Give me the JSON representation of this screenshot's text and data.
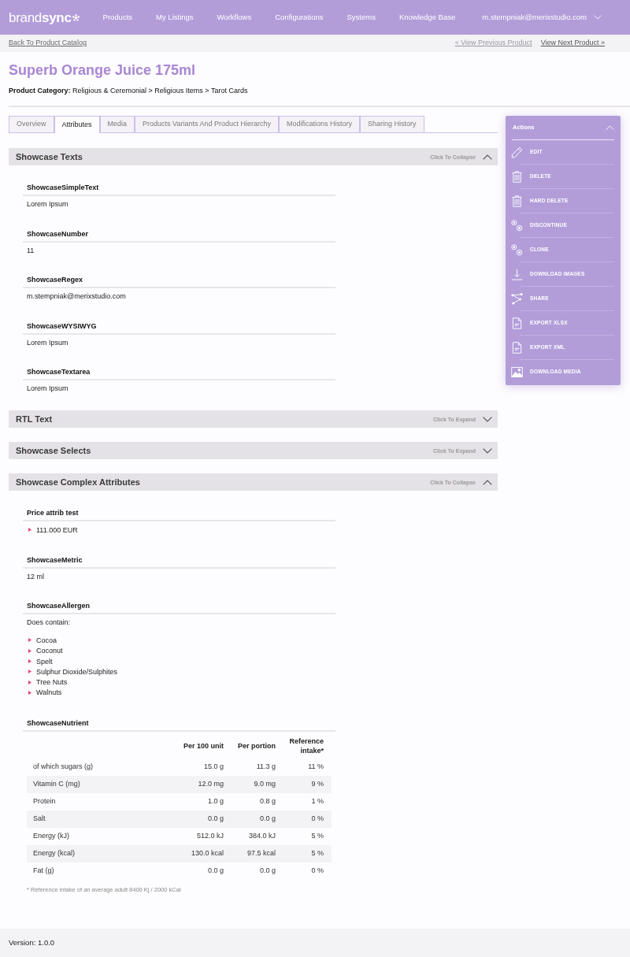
{
  "header": {
    "logo": "brand**sync**",
    "nav": [
      "Products",
      "My Listings",
      "Workflows",
      "Configurations",
      "Systems",
      "Knowledge Base"
    ],
    "user": "m.stempniak@merixstudio.com"
  },
  "subnav": {
    "back": "Back To Product Catalog",
    "previous": {
      "label": "« View Previous Product",
      "disabled": true
    },
    "next": {
      "label": "View Next Product »",
      "disabled": false
    }
  },
  "product": {
    "title": "Superb Orange Juice 175ml",
    "category": "**Product Category:** Religious & Ceremonial > Religious Items > Tarot Cards"
  },
  "tabs": [
    {
      "label": "Overview",
      "selected": false
    },
    {
      "label": "Attributes",
      "selected": true
    },
    {
      "label": "Media",
      "selected": false
    },
    {
      "label": "Products Variants And Product Hierarchy",
      "selected": false
    },
    {
      "label": "Modifications History",
      "selected": false
    },
    {
      "label": "Sharing History",
      "selected": false
    }
  ],
  "sections": [
    {
      "title": "Showcase Texts",
      "toggle": "Click To Collapse",
      "expanded": true,
      "attributes": [
        {
          "kind": "text",
          "label": "ShowcaseSimpleText",
          "value": "Lorem Ipsum"
        },
        {
          "kind": "text",
          "label": "ShowcaseNumber",
          "value": "11"
        },
        {
          "kind": "text",
          "label": "ShowcaseRegex",
          "value": "m.stempniak@merixstudio.com"
        },
        {
          "kind": "text",
          "label": "ShowcaseWYSIWYG",
          "value": "Lorem Ipsum"
        },
        {
          "kind": "text",
          "label": "ShowcaseTextarea",
          "value": "Lorem Ipsum"
        }
      ]
    },
    {
      "title": "RTL Text",
      "toggle": "Click To Expand",
      "expanded": false
    },
    {
      "title": "Showcase Selects",
      "toggle": "Click To Expand",
      "expanded": false
    },
    {
      "title": "Showcase Complex Attributes",
      "toggle": "Click To Collapse",
      "expanded": true,
      "attributes": [
        {
          "kind": "list",
          "label": "Price attrib test",
          "items": [
            "111.000 EUR"
          ]
        },
        {
          "kind": "text",
          "label": "ShowcaseMetric",
          "value": "12 ml"
        },
        {
          "kind": "list",
          "label": "ShowcaseAllergen",
          "intro": "Does contain:",
          "items": [
            "Cocoa",
            "Coconut",
            "Spelt",
            "Sulphur Dioxide/Sulphites",
            "Tree Nuts",
            "Walnuts"
          ]
        },
        {
          "kind": "table",
          "label": "ShowcaseNutrient",
          "columns": [
            "",
            "Per 100 unit",
            "Per portion",
            "Reference intake*"
          ],
          "rows": [
            [
              "of which sugars (g)",
              "15.0 g",
              "11.3 g",
              "11 %"
            ],
            [
              "Vitamin C (mg)",
              "12.0 mg",
              "9.0 mg",
              "9 %"
            ],
            [
              "Protein",
              "1.0 g",
              "0.8 g",
              "1 %"
            ],
            [
              "Salt",
              "0.0 g",
              "0.0 g",
              "0 %"
            ],
            [
              "Energy (kJ)",
              "512.0 kJ",
              "384.0 kJ",
              "5 %"
            ],
            [
              "Energy (kcal)",
              "130.0 kcal",
              "97.5 kcal",
              "5 %"
            ],
            [
              "Fat (g)",
              "0.0 g",
              "0.0 g",
              "0 %"
            ]
          ],
          "footnote": "* Reference intake of an average adult 8400 Kj / 2000 kCal"
        }
      ]
    }
  ],
  "actions": {
    "title": "Actions",
    "expanded": true,
    "items": [
      "EDIT",
      "DELETE",
      "HARD DELETE",
      "DISCONTINUE",
      "CLONE",
      "DOWNLOAD IMAGES",
      "SHARE",
      "EXPORT XLSX",
      "EXPORT XML",
      "DOWNLOAD MEDIA"
    ]
  },
  "footer": {
    "version": "Version: 1.0.0"
  }
}
